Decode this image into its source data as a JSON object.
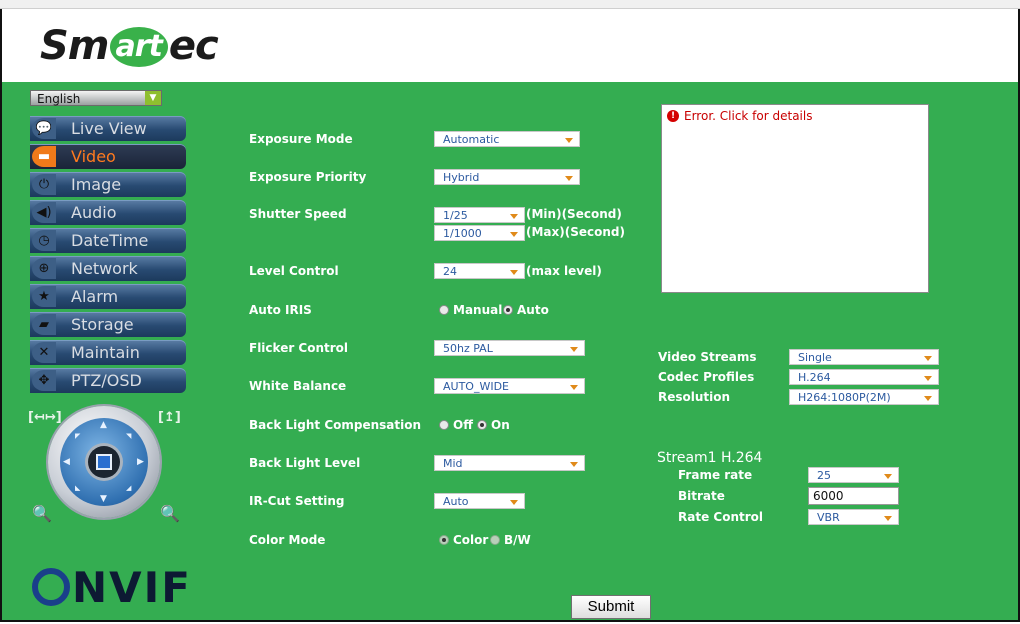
{
  "brand": {
    "logo_left": "Sm",
    "logo_mid": "art",
    "logo_right": "ec",
    "footer_logo": "NVIF",
    "green": "#34ad51"
  },
  "language": {
    "selected": "English"
  },
  "nav": {
    "items": [
      {
        "label": "Live View",
        "icon": "chat-bubble-icon"
      },
      {
        "label": "Video",
        "icon": "video-camera-icon"
      },
      {
        "label": "Image",
        "icon": "power-icon"
      },
      {
        "label": "Audio",
        "icon": "speaker-icon"
      },
      {
        "label": "DateTime",
        "icon": "clock-icon"
      },
      {
        "label": "Network",
        "icon": "globe-icon"
      },
      {
        "label": "Alarm",
        "icon": "alarm-star-icon"
      },
      {
        "label": "Storage",
        "icon": "folder-icon"
      },
      {
        "label": "Maintain",
        "icon": "tools-icon"
      },
      {
        "label": "PTZ/OSD",
        "icon": "ptz-arrows-icon"
      }
    ],
    "active": "Video"
  },
  "ptz": {
    "left_bracket": "[↤↦]",
    "right_bracket": "[↥]"
  },
  "form": {
    "exposure_mode": {
      "label": "Exposure Mode",
      "value": "Automatic"
    },
    "exposure_priority": {
      "label": "Exposure Priority",
      "value": "Hybrid"
    },
    "shutter_speed": {
      "label": "Shutter Speed",
      "min_value": "1/25",
      "min_suffix": "(Min)(Second)",
      "max_value": "1/1000",
      "max_suffix": "(Max)(Second)"
    },
    "level_control": {
      "label": "Level Control",
      "value": "24",
      "suffix": "(max level)"
    },
    "auto_iris": {
      "label": "Auto IRIS",
      "options": [
        "Manual",
        "Auto"
      ],
      "selected": "Auto"
    },
    "flicker_control": {
      "label": "Flicker Control",
      "value": "50hz PAL"
    },
    "white_balance": {
      "label": "White Balance",
      "value": "AUTO_WIDE"
    },
    "backlight_comp": {
      "label": "Back Light Compensation",
      "options": [
        "Off",
        "On"
      ],
      "selected": "On"
    },
    "backlight_level": {
      "label": "Back Light Level",
      "value": "Mid"
    },
    "ircut": {
      "label": "IR-Cut Setting",
      "value": "Auto"
    },
    "color_mode": {
      "label": "Color Mode",
      "options": [
        "Color",
        "B/W"
      ],
      "selected": "Color"
    }
  },
  "error": {
    "text": "Error. Click for details"
  },
  "streams": {
    "video_streams": {
      "label": "Video Streams",
      "value": "Single"
    },
    "codec_profiles": {
      "label": "Codec Profiles",
      "value": "H.264"
    },
    "resolution": {
      "label": "Resolution",
      "value": "H264:1080P(2M)"
    },
    "stream1_title": "Stream1  H.264",
    "frame_rate": {
      "label": "Frame rate",
      "value": "25"
    },
    "bitrate": {
      "label": "Bitrate",
      "value": "6000"
    },
    "rate_control": {
      "label": "Rate Control",
      "value": "VBR"
    }
  },
  "submit_label": "Submit"
}
